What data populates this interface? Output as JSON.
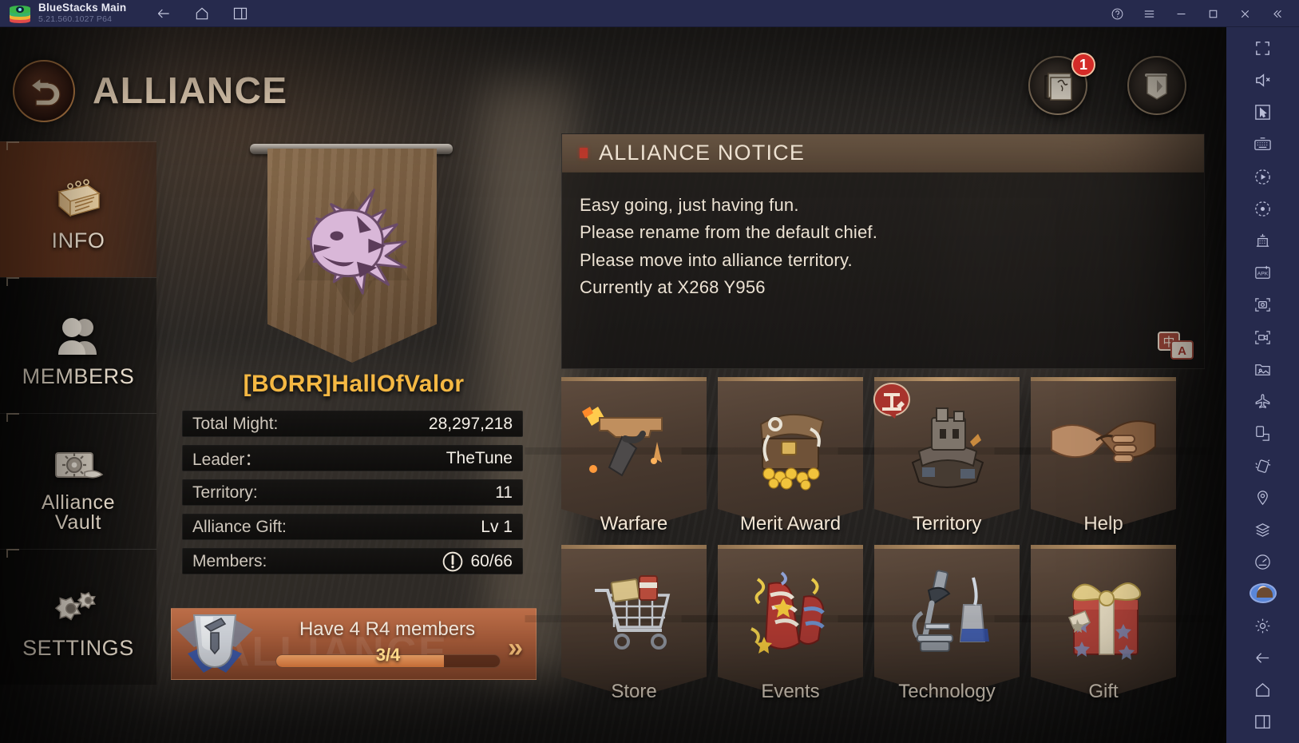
{
  "window": {
    "app_title": "BlueStacks Main",
    "app_version": "5.21.560.1027  P64",
    "nav": [
      {
        "name": "back-icon",
        "label": "Back"
      },
      {
        "name": "home-icon",
        "label": "Home"
      },
      {
        "name": "multi-instance-icon",
        "label": "Multi-instance"
      }
    ],
    "controls": [
      {
        "name": "help-icon",
        "label": "Help"
      },
      {
        "name": "menu-icon",
        "label": "Menu"
      },
      {
        "name": "minimize-icon",
        "label": "Minimize"
      },
      {
        "name": "maximize-icon",
        "label": "Maximize"
      },
      {
        "name": "close-icon",
        "label": "Close"
      },
      {
        "name": "collapse-icon",
        "label": "Collapse sidebar"
      }
    ]
  },
  "header": {
    "title": "ALLIANCE",
    "back_button": "Back"
  },
  "sidebar": {
    "items": [
      {
        "label": "INFO",
        "icon": "notebook-icon",
        "active": true
      },
      {
        "label": "MEMBERS",
        "icon": "people-icon",
        "active": false
      },
      {
        "label": "Alliance\nVault",
        "label_l1": "Alliance",
        "label_l2": "Vault",
        "icon": "vault-icon",
        "active": false
      },
      {
        "label": "SETTINGS",
        "icon": "gears-icon",
        "active": false
      }
    ]
  },
  "alliance": {
    "name": "[BORR]HallOfValor",
    "emblem": "dragon-head-emblem",
    "stats": [
      {
        "key": "Total Might:",
        "value": "28,297,218"
      },
      {
        "key": "Leader：",
        "value": "TheTune"
      },
      {
        "key": "Territory:",
        "value": "11"
      },
      {
        "key": "Alliance Gift:",
        "value": "Lv 1"
      },
      {
        "key": "Members:",
        "value": "60/66",
        "warning": true
      }
    ]
  },
  "quest": {
    "title": "Have 4 R4 members",
    "progress_text": "3/4",
    "progress_percent": 75,
    "arrow": "»"
  },
  "top_buttons": [
    {
      "name": "alliance-mail-button",
      "badge": "1"
    },
    {
      "name": "alliance-banner-button",
      "badge": ""
    }
  ],
  "notice": {
    "title": "ALLIANCE NOTICE",
    "lines": [
      "Easy going, just having fun.",
      "Please rename from the default chief.",
      "Please move into alliance territory.",
      "Currently at X268 Y956"
    ],
    "translate_button": "中A"
  },
  "tiles": {
    "rows": [
      [
        {
          "label": "Warfare",
          "icon": "pistol-icon",
          "badge": ""
        },
        {
          "label": "Merit Award",
          "icon": "treasure-chest-icon",
          "badge": ""
        },
        {
          "label": "Territory",
          "icon": "fortress-icon",
          "badge": "build-icon"
        },
        {
          "label": "Help",
          "icon": "handshake-icon",
          "badge": ""
        }
      ],
      [
        {
          "label": "Store",
          "icon": "shopping-cart-icon",
          "badge": ""
        },
        {
          "label": "Events",
          "icon": "firecracker-icon",
          "badge": ""
        },
        {
          "label": "Technology",
          "icon": "microscope-icon",
          "badge": ""
        },
        {
          "label": "Gift",
          "icon": "gift-box-icon",
          "badge": ""
        }
      ]
    ]
  },
  "right_toolbar": {
    "icons": [
      "fullscreen-icon",
      "mute-icon",
      "cursor-icon",
      "keyboard-icon",
      "macro-play-icon",
      "macro-record-icon",
      "multi-instance-manager-icon",
      "apk-install-icon",
      "screenshot-icon",
      "screen-record-icon",
      "media-manager-icon",
      "airplane-icon",
      "rotate-screen-icon",
      "shake-icon",
      "location-icon",
      "layers-icon",
      "performance-icon"
    ],
    "bottom_icons": [
      "avatar",
      "gear-icon",
      "back-icon",
      "home-icon",
      "multi-instance-icon"
    ]
  },
  "colors": {
    "accent_orange": "#f5b843",
    "quest_bg": "#a85c3a",
    "badge_red": "#d42b28",
    "titlebar": "#262a4d"
  }
}
